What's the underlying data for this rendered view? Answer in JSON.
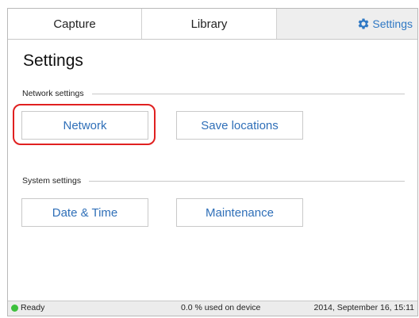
{
  "tabs": {
    "capture": "Capture",
    "library": "Library",
    "settings": "Settings"
  },
  "page": {
    "title": "Settings"
  },
  "sections": {
    "network": {
      "label": "Network settings",
      "buttons": {
        "network": "Network",
        "save_locations": "Save locations"
      }
    },
    "system": {
      "label": "System settings",
      "buttons": {
        "date_time": "Date & Time",
        "maintenance": "Maintenance"
      }
    }
  },
  "status": {
    "ready": "Ready",
    "usage": "0.0 % used on device",
    "date": "2014, September 16, 15:11"
  },
  "icons": {
    "settings": "gear-icon",
    "status": "status-dot-icon"
  },
  "colors": {
    "accent": "#2f78c4",
    "highlight": "#e02020",
    "ready": "#3cc03c"
  }
}
